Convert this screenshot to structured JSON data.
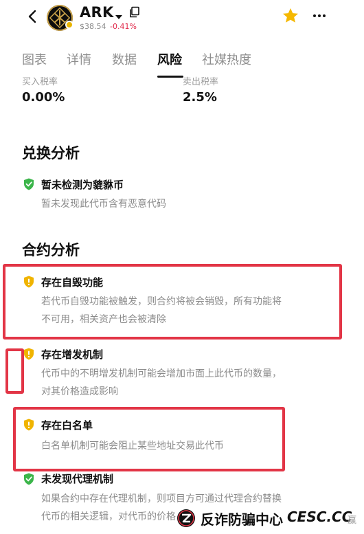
{
  "header": {
    "coin_name": "ARK",
    "price": "$38.54",
    "change": "-0.41%"
  },
  "tabs": [
    "图表",
    "详情",
    "数据",
    "风险",
    "社媒热度"
  ],
  "active_tab_index": 3,
  "tax": {
    "buy_label": "买入税率",
    "buy_value": "0.00%",
    "sell_label": "卖出税率",
    "sell_value": "2.5%"
  },
  "exchange_analysis": {
    "title": "兑换分析",
    "items": [
      {
        "status": "safe",
        "title": "暂未检测为貔貅币",
        "desc_lines": [
          "暂未发现此代币含有恶意代码"
        ]
      }
    ]
  },
  "contract_analysis": {
    "title": "合约分析",
    "items": [
      {
        "status": "warning",
        "title": "存在自毁功能",
        "desc_lines": [
          "若代币自毁功能被触发，则合约将被会销毁，所有功能将",
          "不可用，相关资产也会被清除"
        ]
      },
      {
        "status": "warning",
        "title": "存在增发机制",
        "desc_lines": [
          "代币中的不明增发机制可能会增加市面上此代币的数量，",
          "对其价格造成影响"
        ]
      },
      {
        "status": "warning",
        "title": "存在白名单",
        "desc_lines": [
          "白名单机制可能会阻止某些地址交易此代币"
        ]
      },
      {
        "status": "safe",
        "title": "未发现代理机制",
        "desc_lines": [
          "如果合约中存在代理机制，则项目方可通过代理合约替换",
          "代币的相关逻辑，对代币的价格"
        ]
      }
    ]
  },
  "colors": {
    "safe": "#3bb54a",
    "warning": "#f0b400",
    "negative": "#e0294a",
    "highlight": "#e23546",
    "star": "#f5b800"
  },
  "icons": {
    "back": "chevron-left-icon",
    "favorite": "star-icon",
    "more": "more-horizontal-icon",
    "copy": "copy-icon",
    "safe": "shield-check-icon",
    "warning": "shield-warning-icon"
  },
  "watermark": {
    "text_cn": "反诈防骗中心",
    "text_en": "CESC.CC",
    "side_text": "赢"
  }
}
